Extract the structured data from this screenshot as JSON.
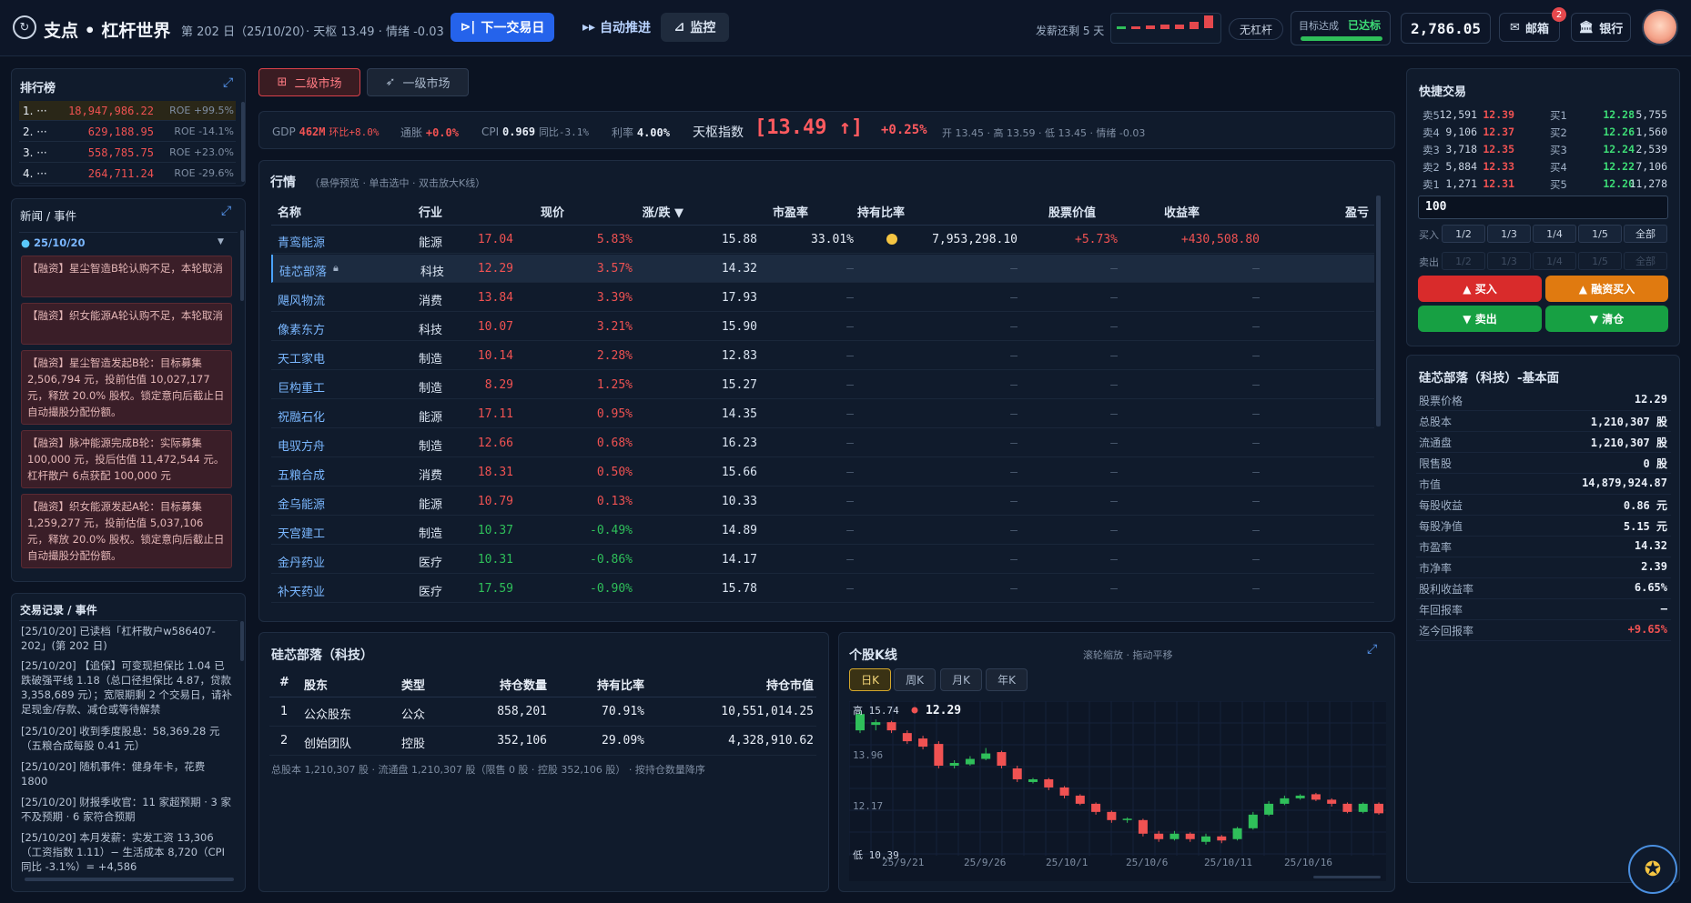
{
  "top": {
    "brand": "支点 • 杠杆世界",
    "dayinfo": "第 202 日（25/10/20）· 天枢 13.49 · 情绪 -0.03",
    "next_day": "下一交易日",
    "auto": "自动推进",
    "monitor": "监控",
    "salary": "发薪还剩 5 天",
    "leverage": "无杠杆",
    "target_label": "目标达成",
    "target_status": "已达标",
    "target_progress": 1.0,
    "cash": "2,786.05",
    "mail": "邮箱",
    "mail_count": "2",
    "bank": "银行"
  },
  "ranking": {
    "title": "排行榜",
    "rows": [
      {
        "rank": "1. ···",
        "value": "18,947,986.22",
        "roe": "ROE +99.5%"
      },
      {
        "rank": "2. ···",
        "value": "629,188.95",
        "roe": "ROE -14.1%"
      },
      {
        "rank": "3. ···",
        "value": "558,785.75",
        "roe": "ROE +23.0%"
      },
      {
        "rank": "4. ···",
        "value": "264,711.24",
        "roe": "ROE -29.6%"
      }
    ]
  },
  "news": {
    "title": "新闻 / 事件",
    "date": "25/10/20",
    "items": [
      "【融资】星尘智造B轮认购不足，本轮取消",
      "【融资】织女能源A轮认购不足，本轮取消",
      "【融资】星尘智造发起B轮：目标募集 2,506,794 元，投前估值 10,027,177 元，释放 20.0% 股权。锁定意向后截止日自动撮股分配份额。",
      "【融资】脉冲能源完成B轮：实际募集 100,000 元，投后估值 11,472,544 元。杠杆散户 6点获配 100,000 元",
      "【融资】织女能源发起A轮：目标募集 1,259,277 元，投前估值 5,037,106 元，释放 20.0% 股权。锁定意向后截止日自动撮股分配份额。"
    ]
  },
  "log": {
    "title": "交易记录 / 事件",
    "items": [
      "[25/10/20] 已读档「杠杆散户w586407-202」(第 202 日)",
      "[25/10/20] 【追保】可变现担保比 1.04 已跌破强平线 1.18（总口径担保比 4.87，贷款 3,358,689 元）；宽限期剩 2 个交易日，请补足现金/存款、减仓或等待解禁",
      "[25/10/20] 收到季度股息：58,369.28 元（五粮合成每股 0.41 元）",
      "[25/10/20] 随机事件：健身年卡，花费 1800",
      "[25/10/20] 财报季收官：11 家超预期 · 3 家不及预期 · 6 家符合预期",
      "[25/10/20] 本月发薪：实发工资 13,306（工资指数 1.11）− 生活成本 8,720（CPI 同比 -3.1%）= +4,586"
    ]
  },
  "tabs": {
    "secondary": "二级市场",
    "primary": "一级市场"
  },
  "macro": {
    "gdp_label": "GDP",
    "gdp_val": "462M",
    "gdp_chg": "环比+8.0%",
    "infl_label": "通胀",
    "infl_val": "+0.0%",
    "cpi_label": "CPI",
    "cpi_val": "0.969",
    "cpi_chg": "同比-3.1%",
    "rate_label": "利率",
    "rate_val": "4.00%",
    "index_label": "天枢指数",
    "index_val": "[13.49 ↑]",
    "index_chg": "+0.25%",
    "index_detail": "开 13.45 · 高 13.59 · 低 13.45 · 情绪 -0.03"
  },
  "market": {
    "title": "行情",
    "hint": "（悬停预览 · 单击选中 · 双击放大K线）",
    "headers": {
      "name": "名称",
      "industry": "行业",
      "price": "现价",
      "change": "涨/跌 ▼",
      "pe": "市盈率",
      "hold": "持有比率",
      "value": "股票价值",
      "ret": "收益率",
      "pnl": "盈亏"
    },
    "rows": [
      {
        "name": "青鸾能源",
        "industry": "能源",
        "price": "17.04",
        "change": "5.83%",
        "pe": "15.88",
        "hold": "33.01%",
        "value": "7,953,298.10",
        "ret": "+5.73%",
        "pnl": "+430,508.80",
        "up": true
      },
      {
        "name": "硅芯部落",
        "industry": "科技",
        "price": "12.29",
        "change": "3.57%",
        "pe": "14.32",
        "hold": "—",
        "value": "—",
        "ret": "—",
        "pnl": "—",
        "up": true
      },
      {
        "name": "飓风物流",
        "industry": "消费",
        "price": "13.84",
        "change": "3.39%",
        "pe": "17.93",
        "hold": "—",
        "value": "—",
        "ret": "—",
        "pnl": "—",
        "up": true
      },
      {
        "name": "像素东方",
        "industry": "科技",
        "price": "10.07",
        "change": "3.21%",
        "pe": "15.90",
        "hold": "—",
        "value": "—",
        "ret": "—",
        "pnl": "—",
        "up": true
      },
      {
        "name": "天工家电",
        "industry": "制造",
        "price": "10.14",
        "change": "2.28%",
        "pe": "12.83",
        "hold": "—",
        "value": "—",
        "ret": "—",
        "pnl": "—",
        "up": true
      },
      {
        "name": "巨构重工",
        "industry": "制造",
        "price": "8.29",
        "change": "1.25%",
        "pe": "15.27",
        "hold": "—",
        "value": "—",
        "ret": "—",
        "pnl": "—",
        "up": true
      },
      {
        "name": "祝融石化",
        "industry": "能源",
        "price": "17.11",
        "change": "0.95%",
        "pe": "14.35",
        "hold": "—",
        "value": "—",
        "ret": "—",
        "pnl": "—",
        "up": true
      },
      {
        "name": "电驭方舟",
        "industry": "制造",
        "price": "12.66",
        "change": "0.68%",
        "pe": "16.23",
        "hold": "—",
        "value": "—",
        "ret": "—",
        "pnl": "—",
        "up": true
      },
      {
        "name": "五粮合成",
        "industry": "消费",
        "price": "18.31",
        "change": "0.50%",
        "pe": "15.66",
        "hold": "—",
        "value": "—",
        "ret": "—",
        "pnl": "—",
        "up": true
      },
      {
        "name": "金乌能源",
        "industry": "能源",
        "price": "10.79",
        "change": "0.13%",
        "pe": "10.33",
        "hold": "—",
        "value": "—",
        "ret": "—",
        "pnl": "—",
        "up": true
      },
      {
        "name": "天宫建工",
        "industry": "制造",
        "price": "10.37",
        "change": "-0.49%",
        "pe": "14.89",
        "hold": "—",
        "value": "—",
        "ret": "—",
        "pnl": "—",
        "up": false
      },
      {
        "name": "金丹药业",
        "industry": "医疗",
        "price": "10.31",
        "change": "-0.86%",
        "pe": "14.17",
        "hold": "—",
        "value": "—",
        "ret": "—",
        "pnl": "—",
        "up": false
      },
      {
        "name": "补天药业",
        "industry": "医疗",
        "price": "17.59",
        "change": "-0.90%",
        "pe": "15.78",
        "hold": "—",
        "value": "—",
        "ret": "—",
        "pnl": "—",
        "up": false
      }
    ]
  },
  "holders": {
    "title": "硅芯部落（科技）",
    "headers": {
      "no": "#",
      "holder": "股东",
      "type": "类型",
      "qty": "持仓数量",
      "ratio": "持有比率",
      "value": "持仓市值"
    },
    "rows": [
      {
        "no": "1",
        "holder": "公众股东",
        "type": "公众",
        "qty": "858,201",
        "ratio": "70.91%",
        "value": "10,551,014.25"
      },
      {
        "no": "2",
        "holder": "创始团队",
        "type": "控股",
        "qty": "352,106",
        "ratio": "29.09%",
        "value": "4,328,910.62"
      }
    ],
    "footer": "总股本 1,210,307 股 · 流通盘 1,210,307 股（限售 0 股 · 控股 352,106 股） · 按持仓数量降序"
  },
  "kline": {
    "title": "个股K线",
    "hint": "滚轮缩放 · 拖动平移",
    "periods": [
      "日K",
      "周K",
      "月K",
      "年K"
    ],
    "high_label": "高 15.74",
    "low_label": "低 10.39",
    "last": "12.29",
    "ylabels": [
      "13.96",
      "12.17"
    ],
    "xlabels": [
      "25/9/21",
      "25/9/26",
      "25/10/1",
      "25/10/6",
      "25/10/11",
      "25/10/16"
    ]
  },
  "chart_data": {
    "type": "candlestick",
    "ylim": [
      10.39,
      15.74
    ],
    "candles": [
      {
        "o": 15.0,
        "c": 15.6,
        "h": 15.74,
        "l": 14.9
      },
      {
        "o": 15.2,
        "c": 15.3,
        "h": 15.4,
        "l": 15.0
      },
      {
        "o": 15.3,
        "c": 15.0,
        "h": 15.35,
        "l": 14.9
      },
      {
        "o": 14.9,
        "c": 14.6,
        "h": 15.0,
        "l": 14.5
      },
      {
        "o": 14.7,
        "c": 14.4,
        "h": 14.8,
        "l": 14.3
      },
      {
        "o": 14.5,
        "c": 13.7,
        "h": 14.6,
        "l": 13.6
      },
      {
        "o": 13.7,
        "c": 13.8,
        "h": 13.9,
        "l": 13.6
      },
      {
        "o": 13.75,
        "c": 13.95,
        "h": 14.05,
        "l": 13.7
      },
      {
        "o": 13.95,
        "c": 14.15,
        "h": 14.35,
        "l": 13.9
      },
      {
        "o": 14.2,
        "c": 13.7,
        "h": 14.25,
        "l": 13.6
      },
      {
        "o": 13.6,
        "c": 13.2,
        "h": 13.7,
        "l": 13.1
      },
      {
        "o": 13.1,
        "c": 13.2,
        "h": 13.25,
        "l": 13.05
      },
      {
        "o": 13.2,
        "c": 12.9,
        "h": 13.25,
        "l": 12.8
      },
      {
        "o": 12.9,
        "c": 12.6,
        "h": 12.95,
        "l": 12.5
      },
      {
        "o": 12.6,
        "c": 12.3,
        "h": 12.65,
        "l": 12.25
      },
      {
        "o": 12.3,
        "c": 12.0,
        "h": 12.35,
        "l": 11.9
      },
      {
        "o": 12.0,
        "c": 11.7,
        "h": 12.05,
        "l": 11.6
      },
      {
        "o": 11.7,
        "c": 11.75,
        "h": 11.8,
        "l": 11.6
      },
      {
        "o": 11.7,
        "c": 11.2,
        "h": 11.75,
        "l": 11.1
      },
      {
        "o": 11.2,
        "c": 11.0,
        "h": 11.3,
        "l": 10.9
      },
      {
        "o": 11.0,
        "c": 11.2,
        "h": 11.3,
        "l": 10.95
      },
      {
        "o": 11.2,
        "c": 11.0,
        "h": 11.25,
        "l": 10.9
      },
      {
        "o": 10.9,
        "c": 11.1,
        "h": 11.2,
        "l": 10.8
      },
      {
        "o": 11.1,
        "c": 10.95,
        "h": 11.15,
        "l": 10.85
      },
      {
        "o": 11.0,
        "c": 11.4,
        "h": 11.45,
        "l": 10.95
      },
      {
        "o": 11.4,
        "c": 11.9,
        "h": 12.0,
        "l": 11.35
      },
      {
        "o": 11.9,
        "c": 12.3,
        "h": 12.4,
        "l": 11.85
      },
      {
        "o": 12.3,
        "c": 12.5,
        "h": 12.6,
        "l": 12.25
      },
      {
        "o": 12.5,
        "c": 12.6,
        "h": 12.65,
        "l": 12.45
      },
      {
        "o": 12.65,
        "c": 12.45,
        "h": 12.7,
        "l": 12.4
      },
      {
        "o": 12.45,
        "c": 12.3,
        "h": 12.5,
        "l": 12.2
      },
      {
        "o": 12.3,
        "c": 12.0,
        "h": 12.35,
        "l": 11.95
      },
      {
        "o": 12.0,
        "c": 12.3,
        "h": 12.35,
        "l": 11.95
      },
      {
        "o": 12.3,
        "c": 11.95,
        "h": 12.35,
        "l": 11.9
      }
    ]
  },
  "trade": {
    "title": "快捷交易",
    "asks": [
      {
        "label": "卖5",
        "price": "12.39",
        "qty": "12,591"
      },
      {
        "label": "卖4",
        "price": "12.37",
        "qty": "9,106"
      },
      {
        "label": "卖3",
        "price": "12.35",
        "qty": "3,718"
      },
      {
        "label": "卖2",
        "price": "12.33",
        "qty": "5,884"
      },
      {
        "label": "卖1",
        "price": "12.31",
        "qty": "1,271"
      }
    ],
    "bids": [
      {
        "label": "买1",
        "price": "12.28",
        "qty": "5,755"
      },
      {
        "label": "买2",
        "price": "12.26",
        "qty": "1,560"
      },
      {
        "label": "买3",
        "price": "12.24",
        "qty": "2,539"
      },
      {
        "label": "买4",
        "price": "12.22",
        "qty": "7,106"
      },
      {
        "label": "买5",
        "price": "12.20",
        "qty": "11,278"
      }
    ],
    "qty_value": "100",
    "buy_label": "买入",
    "sell_label": "卖出",
    "fractions": [
      "1/2",
      "1/3",
      "1/4",
      "1/5",
      "全部"
    ],
    "btn_buy": "▲ 买入",
    "btn_margin": "▲ 融资买入",
    "btn_sell": "▼ 卖出",
    "btn_clear": "▼ 清仓"
  },
  "fundamentals": {
    "title": "硅芯部落（科技）-基本面",
    "rows": [
      {
        "k": "股票价格",
        "v": "12.29"
      },
      {
        "k": "总股本",
        "v": "1,210,307 股"
      },
      {
        "k": "流通盘",
        "v": "1,210,307 股"
      },
      {
        "k": "限售股",
        "v": "0 股"
      },
      {
        "k": "市值",
        "v": "14,879,924.87"
      },
      {
        "k": "每股收益",
        "v": "0.86 元"
      },
      {
        "k": "每股净值",
        "v": "5.15 元"
      },
      {
        "k": "市盈率",
        "v": "14.32"
      },
      {
        "k": "市净率",
        "v": "2.39"
      },
      {
        "k": "股利收益率",
        "v": "6.65%"
      },
      {
        "k": "年回报率",
        "v": "—"
      },
      {
        "k": "迄今回报率",
        "v": "+9.65%"
      }
    ]
  }
}
